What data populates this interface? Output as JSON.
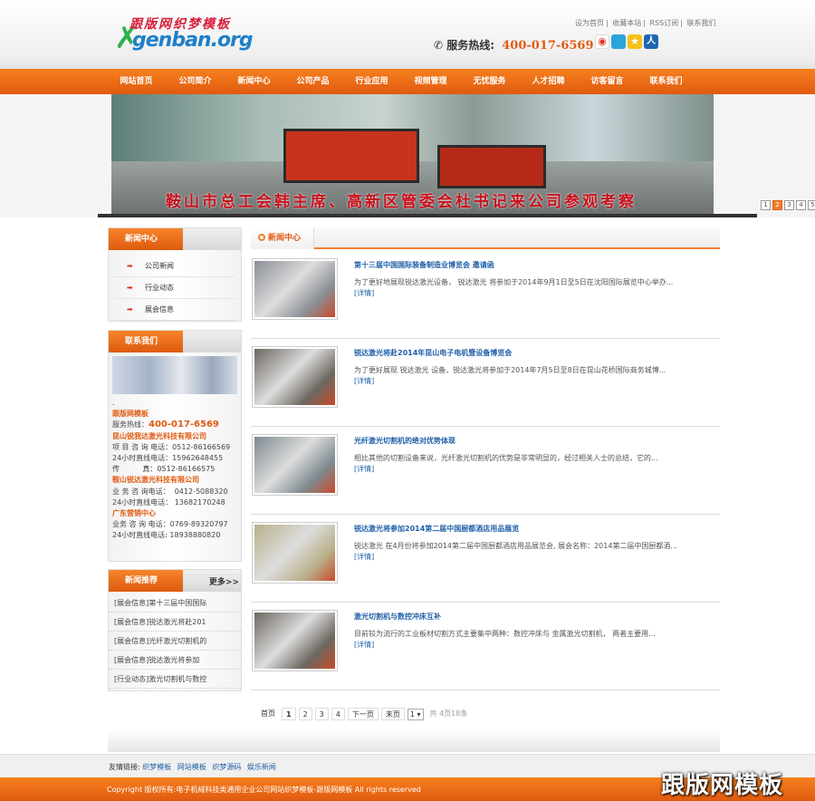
{
  "header": {
    "logo_cn": "跟版网织梦模板",
    "logo_en": "genban.org",
    "top_links": [
      "设为首页",
      "收藏本站",
      "RSS订阅",
      "联系我们"
    ],
    "hotline_label": "服务热线:",
    "hotline_number": "400-017-6569",
    "social_icons": [
      "weibo-icon",
      "qq-weibo-icon",
      "qzone-icon",
      "renren-icon"
    ]
  },
  "nav": {
    "items": [
      "网站首页",
      "公司简介",
      "新闻中心",
      "公司产品",
      "行业应用",
      "视频管理",
      "无忧服务",
      "人才招聘",
      "访客留言",
      "联系我们"
    ]
  },
  "banner": {
    "caption": "鞍山市总工会韩主席、高新区管委会杜书记来公司参观考察",
    "pages": [
      "1",
      "2",
      "3",
      "4",
      "5"
    ],
    "active_page": 2
  },
  "sidebar": {
    "news_center": {
      "title": "新闻中心",
      "items": [
        "公司新闻",
        "行业动态",
        "展会信息"
      ]
    },
    "contact": {
      "title": "联系我们",
      "dot": ".",
      "brand": "跟版网模板",
      "hotline_label": "服务热线：",
      "hotline": "400-017-6569",
      "lines": [
        {
          "text": "昆山锐我达激光科技有限公司",
          "style": "or"
        },
        {
          "text": "项 目 咨 询 电话：0512-86166569",
          "style": ""
        },
        {
          "text": "24小时直线电话：15962648455",
          "style": ""
        },
        {
          "text": "传          真：0512-86166575",
          "style": ""
        },
        {
          "text": "鞍山锐达激光科技有限公司",
          "style": "or"
        },
        {
          "text": "业 务 咨 询电话：  0412-5088320",
          "style": ""
        },
        {
          "text": "24小时直线电话： 13682170248",
          "style": ""
        },
        {
          "text": "广东营销中心",
          "style": "or"
        },
        {
          "text": "业务 咨 询 电话：0769-89320797",
          "style": ""
        },
        {
          "text": "24小时直线电话: 18938880820",
          "style": ""
        }
      ]
    },
    "recommend": {
      "title": "新闻推荐",
      "more": "更多>>",
      "items": [
        "[展会信息]第十三届中国国际",
        "[展会信息]锐达激光将赴201",
        "[展会信息]光纤激光切割机的",
        "[展会信息]锐达激光将参加",
        "[行业动态]激光切割机与数控"
      ]
    }
  },
  "main": {
    "title": "新闻中心",
    "more_label": "[详情]",
    "news": [
      {
        "title": "第十三届中国国际装备制造业博览会 邀请函",
        "desc": "为了更好地展现锐达激光设备， 锐达激光 将参加于2014年9月1日至5日在沈阳国际展览中心举办...",
        "thumb": "#8b8f95"
      },
      {
        "title": "锐达激光将赴2014年昆山电子电机暨设备博览会",
        "desc": "为了更好展现 锐达激光 设备，锐达激光将参加于2014年7月5日至8日在昆山花桥国际商务城博...",
        "thumb": "#6c6760"
      },
      {
        "title": "光纤激光切割机的绝对优势体现",
        "desc": "相比其他的切割设备来说，光纤激光切割机的优势是非常明显的，经过相关人士的总结，它的...",
        "thumb": "#7f8a90"
      },
      {
        "title": "锐达激光将参加2014第二届中国厨都酒店用品展览",
        "desc": "锐达激光 在4月份将参加2014第二届中国厨都酒店用品展览会, 展会名称：2014第二届中国厨都酒...",
        "thumb": "#b9b08a"
      },
      {
        "title": "激光切割机与数控冲床互补",
        "desc": "目前较为流行的工业板材切割方式主要集中两种：数控冲床与 金属激光切割机， 两者主要用...",
        "thumb": "#6c6760"
      }
    ]
  },
  "pagination": {
    "first": "首页",
    "pages": [
      "1",
      "2",
      "3",
      "4"
    ],
    "next": "下一页",
    "last": "末页",
    "select_value": "1",
    "total": "共 4页18条"
  },
  "footer": {
    "links_label": "友情链接:",
    "links": [
      "织梦模板",
      "网站模板",
      "织梦源码",
      "娱乐新闻"
    ],
    "copyright": "Copyright 版权所有:电子机械科技类通用企业公司网站织梦模板-跟版网模板 All rights reserved",
    "watermark": "跟版网模板"
  }
}
